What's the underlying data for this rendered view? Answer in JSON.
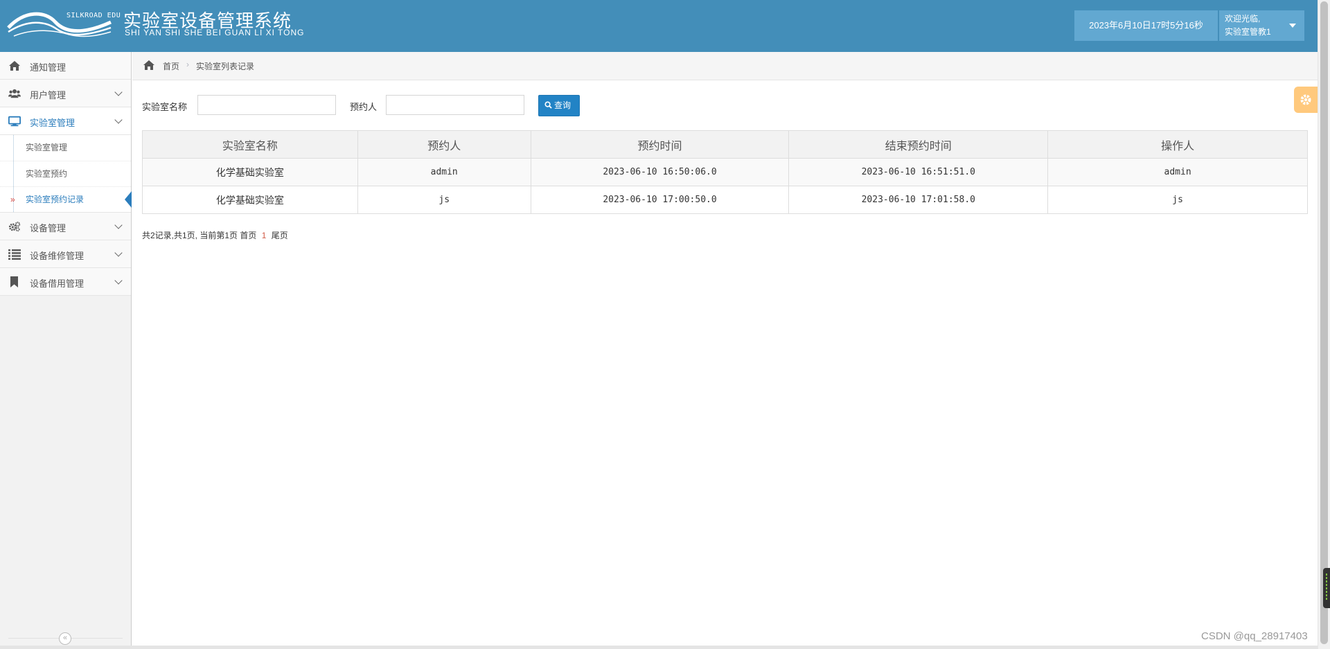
{
  "header": {
    "logo_text": "SILKROAD EDU",
    "title_cn": "实验室设备管理系统",
    "title_en": "SHI YAN SHI SHE BEI GUAN LI XI TONG",
    "datetime": "2023年6月10日17时5分16秒",
    "welcome": "欢迎光临,",
    "username": "实验室管教1"
  },
  "sidebar": {
    "items": [
      {
        "label": "通知管理",
        "icon": "home-icon",
        "has_children": false
      },
      {
        "label": "用户管理",
        "icon": "users-icon",
        "has_children": true
      },
      {
        "label": "实验室管理",
        "icon": "desktop-icon",
        "has_children": true,
        "open": true,
        "children": [
          {
            "label": "实验室管理"
          },
          {
            "label": "实验室预约"
          },
          {
            "label": "实验室预约记录",
            "active": true
          }
        ]
      },
      {
        "label": "设备管理",
        "icon": "cogs-icon",
        "has_children": true
      },
      {
        "label": "设备维修管理",
        "icon": "list-icon",
        "has_children": true
      },
      {
        "label": "设备借用管理",
        "icon": "bookmark-icon",
        "has_children": true
      }
    ],
    "collapse_glyph": "«"
  },
  "breadcrumb": {
    "home": "首页",
    "separator": "›",
    "current": "实验室列表记录"
  },
  "search": {
    "lab_name_label": "实验室名称",
    "lab_name_value": "",
    "booker_label": "预约人",
    "booker_value": "",
    "button_label": "查询"
  },
  "table": {
    "headers": [
      "实验室名称",
      "预约人",
      "预约时间",
      "结束预约时间",
      "操作人"
    ],
    "rows": [
      [
        "化学基础实验室",
        "admin",
        "2023-06-10 16:50:06.0",
        "2023-06-10 16:51:51.0",
        "admin"
      ],
      [
        "化学基础实验室",
        "js",
        "2023-06-10 17:00:50.0",
        "2023-06-10 17:01:58.0",
        "js"
      ]
    ]
  },
  "pager": {
    "summary": "共2记录,共1页, 当前第1页",
    "first": "首页",
    "current_page": "1",
    "last": "尾页"
  },
  "watermark": "CSDN @qq_28917403",
  "colors": {
    "header_bg": "#438eb9",
    "header_box": "#62a8d1",
    "active_blue": "#2b7dbc",
    "button_blue": "#2283c5",
    "settings_orange": "#ffb752",
    "pager_current": "#d15b47"
  }
}
